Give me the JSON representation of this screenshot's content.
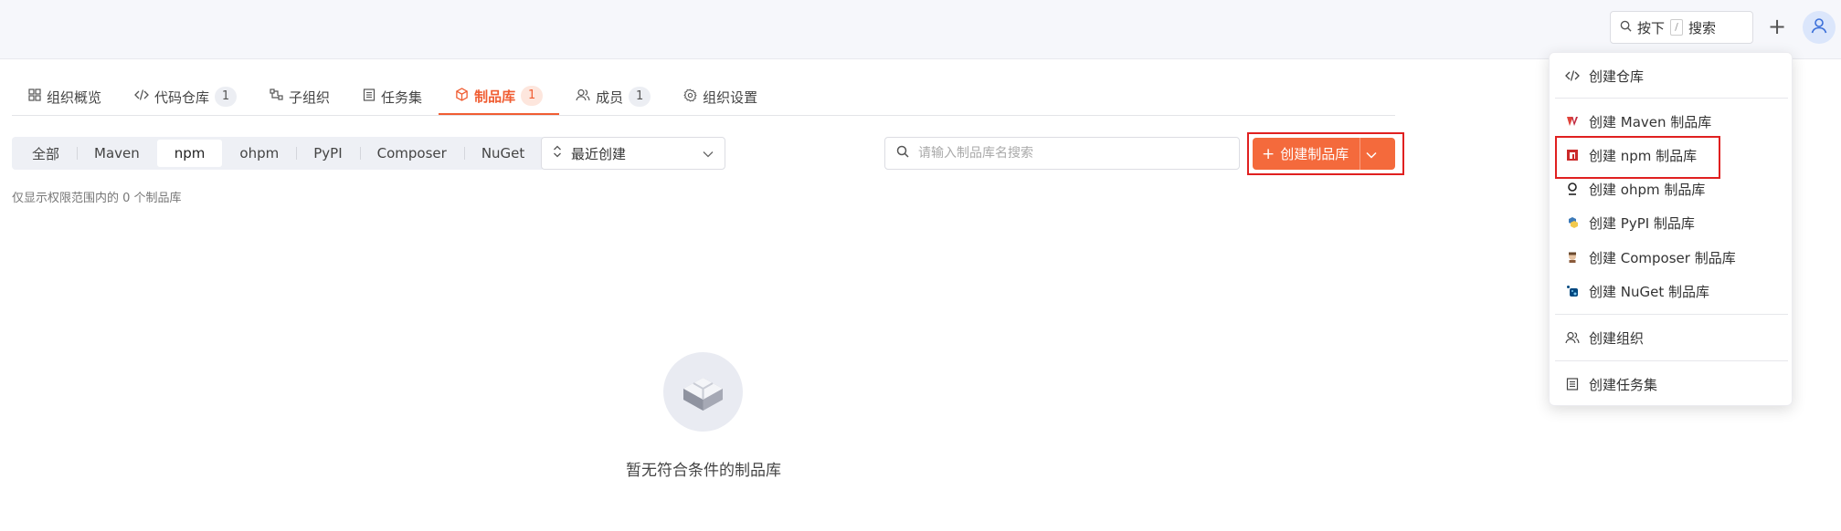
{
  "header": {
    "search": {
      "prefix": "按下",
      "key": "/",
      "suffix": "搜索"
    }
  },
  "tabs": [
    {
      "label": "组织概览",
      "icon": "grid-icon",
      "badge": null,
      "active": false
    },
    {
      "label": "代码仓库",
      "icon": "code-icon",
      "badge": "1",
      "active": false
    },
    {
      "label": "子组织",
      "icon": "suborg-icon",
      "badge": null,
      "active": false
    },
    {
      "label": "任务集",
      "icon": "list-icon",
      "badge": null,
      "active": false
    },
    {
      "label": "制品库",
      "icon": "cube-icon",
      "badge": "1",
      "active": true
    },
    {
      "label": "成员",
      "icon": "members-icon",
      "badge": "1",
      "active": false
    },
    {
      "label": "组织设置",
      "icon": "gear-icon",
      "badge": null,
      "active": false
    }
  ],
  "filters": {
    "types": [
      "全部",
      "Maven",
      "npm",
      "ohpm",
      "PyPI",
      "Composer",
      "NuGet"
    ],
    "active_index": 2
  },
  "sort": {
    "selected": "最近创建"
  },
  "search": {
    "placeholder": "请输入制品库名搜索"
  },
  "create_button": {
    "label": "创建制品库"
  },
  "hint": "仅显示权限范围内的 0 个制品库",
  "empty": {
    "text": "暂无符合条件的制品库"
  },
  "menu": {
    "create_repo": "创建仓库",
    "maven": "创建 Maven 制品库",
    "npm": "创建 npm 制品库",
    "ohpm": "创建 ohpm 制品库",
    "pypi": "创建 PyPI 制品库",
    "composer": "创建 Composer 制品库",
    "nuget": "创建 NuGet 制品库",
    "create_org": "创建组织",
    "create_taskset": "创建任务集"
  },
  "colors": {
    "accent": "#f46a3c",
    "highlight_border": "#e02020"
  }
}
